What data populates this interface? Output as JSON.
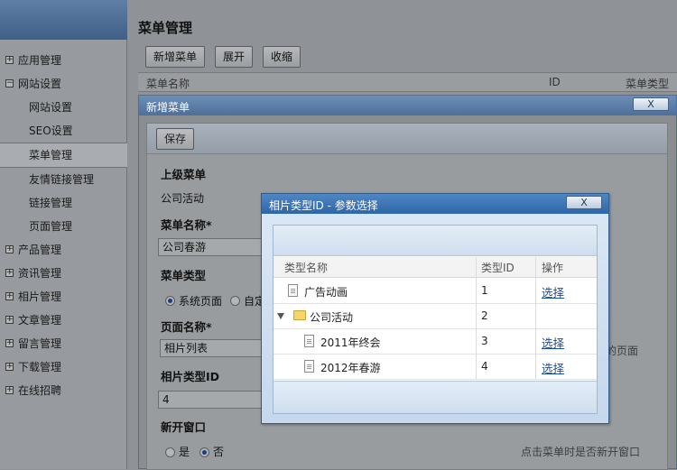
{
  "sidebar": {
    "items": [
      {
        "label": "应用管理",
        "level": "top",
        "expander": "+"
      },
      {
        "label": "网站设置",
        "level": "top",
        "expander": "−"
      },
      {
        "label": "网站设置",
        "level": "sub"
      },
      {
        "label": "SEO设置",
        "level": "sub"
      },
      {
        "label": "菜单管理",
        "level": "sub",
        "selected": true
      },
      {
        "label": "友情链接管理",
        "level": "sub"
      },
      {
        "label": "链接管理",
        "level": "sub"
      },
      {
        "label": "页面管理",
        "level": "sub"
      },
      {
        "label": "产品管理",
        "level": "top",
        "expander": "+"
      },
      {
        "label": "资讯管理",
        "level": "top",
        "expander": "+"
      },
      {
        "label": "相片管理",
        "level": "top",
        "expander": "+"
      },
      {
        "label": "文章管理",
        "level": "top",
        "expander": "+"
      },
      {
        "label": "留言管理",
        "level": "top",
        "expander": "+"
      },
      {
        "label": "下载管理",
        "level": "top",
        "expander": "+"
      },
      {
        "label": "在线招聘",
        "level": "top",
        "expander": "+"
      }
    ]
  },
  "main": {
    "title": "菜单管理",
    "toolbar": {
      "add": "新增菜单",
      "expand": "展开",
      "collapse": "收缩"
    },
    "list_headers": {
      "name": "菜单名称",
      "id": "ID",
      "type": "菜单类型"
    }
  },
  "dialog1": {
    "title": "新增菜单",
    "close": "X",
    "save": "保存",
    "parent_label": "上级菜单",
    "parent_value": "公司活动",
    "name_label": "菜单名称*",
    "name_value": "公司春游",
    "type_label": "菜单类型",
    "type_opt1": "系统页面",
    "type_opt2": "自定",
    "page_label": "页面名称*",
    "page_value": "相片列表",
    "page_hint": "的页面",
    "photo_type_label": "相片类型ID",
    "photo_type_value": "4",
    "new_window_label": "新开窗口",
    "yes": "是",
    "no": "否",
    "new_window_hint": "点击菜单时是否新开窗口"
  },
  "dialog2": {
    "title": "相片类型ID - 参数选择",
    "close": "X",
    "headers": {
      "name": "类型名称",
      "id": "类型ID",
      "op": "操作"
    },
    "rows": [
      {
        "name": "广告动画",
        "id": "1",
        "op": "选择",
        "icon": "document-icon"
      },
      {
        "name": "公司活动",
        "id": "2",
        "op": "",
        "icon": "folder-icon"
      },
      {
        "name": "2011年终会",
        "id": "3",
        "op": "选择",
        "icon": "document-icon"
      },
      {
        "name": "2012年春游",
        "id": "4",
        "op": "选择",
        "icon": "document-icon"
      }
    ]
  }
}
